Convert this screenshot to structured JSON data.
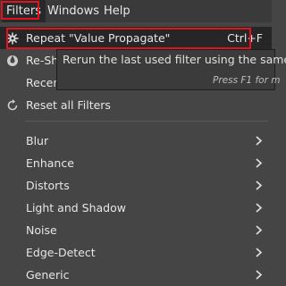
{
  "menubar": {
    "items": [
      {
        "label": "Filters"
      },
      {
        "label": "Windows"
      },
      {
        "label": "Help"
      }
    ]
  },
  "menu": {
    "repeat": {
      "label": "Repeat \"Value Propagate\"",
      "shortcut": "Ctrl+F",
      "icon": "gear-icon"
    },
    "reshow": {
      "label": "Re-Sh",
      "icon": "reshow-icon"
    },
    "recent": {
      "label": "Recen"
    },
    "reset": {
      "label": "Reset all Filters",
      "icon": "reset-icon"
    },
    "categories": [
      {
        "label": "Blur"
      },
      {
        "label": "Enhance"
      },
      {
        "label": "Distorts"
      },
      {
        "label": "Light and Shadow"
      },
      {
        "label": "Noise"
      },
      {
        "label": "Edge-Detect"
      },
      {
        "label": "Generic"
      }
    ]
  },
  "tooltip": {
    "text": "Rerun the last used filter using the same",
    "hint": "Press F1 for m"
  },
  "colors": {
    "menu_bg": "#454545",
    "highlight": "#262626",
    "annotation_red": "#e0141e"
  }
}
